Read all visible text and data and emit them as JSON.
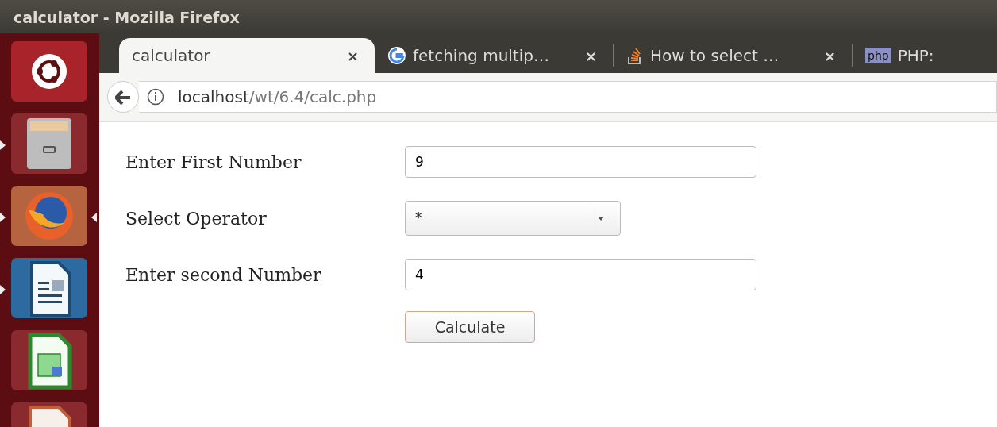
{
  "window": {
    "title": "calculator - Mozilla Firefox"
  },
  "launcher": {
    "items": [
      {
        "kind": "ubuntu",
        "running": false,
        "focused": false
      },
      {
        "kind": "files",
        "running": true,
        "focused": false
      },
      {
        "kind": "firefox",
        "running": true,
        "focused": true
      },
      {
        "kind": "writer",
        "running": true,
        "focused": false
      },
      {
        "kind": "calc",
        "running": false,
        "focused": false
      },
      {
        "kind": "impress",
        "running": false,
        "focused": false
      }
    ]
  },
  "tabs": [
    {
      "label": "calculator",
      "selected": true,
      "kind": "plain",
      "close": "×"
    },
    {
      "label": "fetching multip…",
      "selected": false,
      "kind": "google",
      "close": "×"
    },
    {
      "label": "How to select …",
      "selected": false,
      "kind": "stackoverflow",
      "close": "×"
    },
    {
      "label": "PHP:",
      "selected": false,
      "kind": "php",
      "favicon_text": "php"
    }
  ],
  "address": {
    "host": "localhost",
    "path": "/wt/6.4/calc.php"
  },
  "form": {
    "fields": [
      {
        "kind": "text",
        "label": "Enter First Number",
        "value": "9"
      },
      {
        "kind": "select",
        "label": "Select Operator",
        "value": "*"
      },
      {
        "kind": "text",
        "label": "Enter second Number",
        "value": "4"
      }
    ],
    "button": "Calculate"
  }
}
